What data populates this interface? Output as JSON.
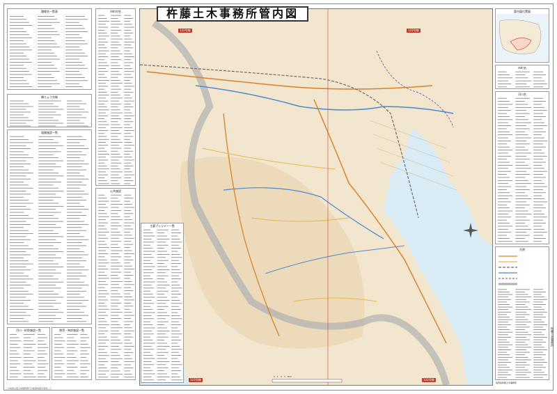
{
  "map": {
    "title": "杵藤土木事務所管内図",
    "route_badges": [
      "122号線",
      "122号線",
      "122号線",
      "122号線"
    ],
    "colors": {
      "land": "#f2e6cf",
      "sea": "#d9ebf5",
      "national_road": "#d9822b",
      "prefectural_road": "#e6b84a",
      "river": "#4a8ad1",
      "railway": "#6b6b6b",
      "boundary": "#b0b0b0",
      "admin_line": "#9b59b6"
    },
    "compass_icon": "compass-rose-icon",
    "bottom_scale_label": "0　1　2　3　4km"
  },
  "left_panels": {
    "col1_titles": [
      "路線名一覧表",
      "橋りょう台帳",
      "道路施設一覧",
      "河川・砂防施設一覧",
      "港湾・海岸施設一覧",
      "港湾施設一覧"
    ],
    "col2_titles": [
      "市町村名",
      "公共施設",
      "凡例"
    ],
    "list_panel_title": "主要プレジャー一覧"
  },
  "right_panels": {
    "titles": [
      "管内図位置図",
      "市町名",
      "河川名",
      "凡例"
    ],
    "office_note": "佐賀県杵藤土木事務所"
  },
  "side_note": "杵藤土木事務所",
  "bottom_note": "この地図は国土地理院発行の数値地図を使用した"
}
